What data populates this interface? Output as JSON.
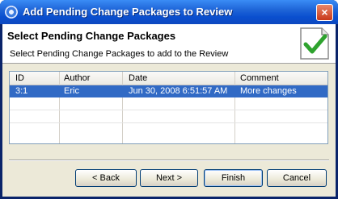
{
  "window": {
    "title": "Add Pending Change Packages to Review",
    "close_label": "×"
  },
  "header": {
    "title": "Select Pending Change Packages",
    "description": "Select Pending Change Packages to add to the Review",
    "image_icon": "document-checkmark-icon"
  },
  "table": {
    "columns": [
      "ID",
      "Author",
      "Date",
      "Comment"
    ],
    "rows": [
      {
        "id": "3:1",
        "author": "Eric",
        "date": "Jun 30, 2008 6:51:57 AM",
        "comment": "More changes",
        "selected": true
      }
    ]
  },
  "buttons": {
    "back": "< Back",
    "next": "Next >",
    "finish": "Finish",
    "cancel": "Cancel"
  },
  "colors": {
    "selection": "#316ac5",
    "titlebar": "#0a4fcf",
    "check": "#2ea32e"
  }
}
